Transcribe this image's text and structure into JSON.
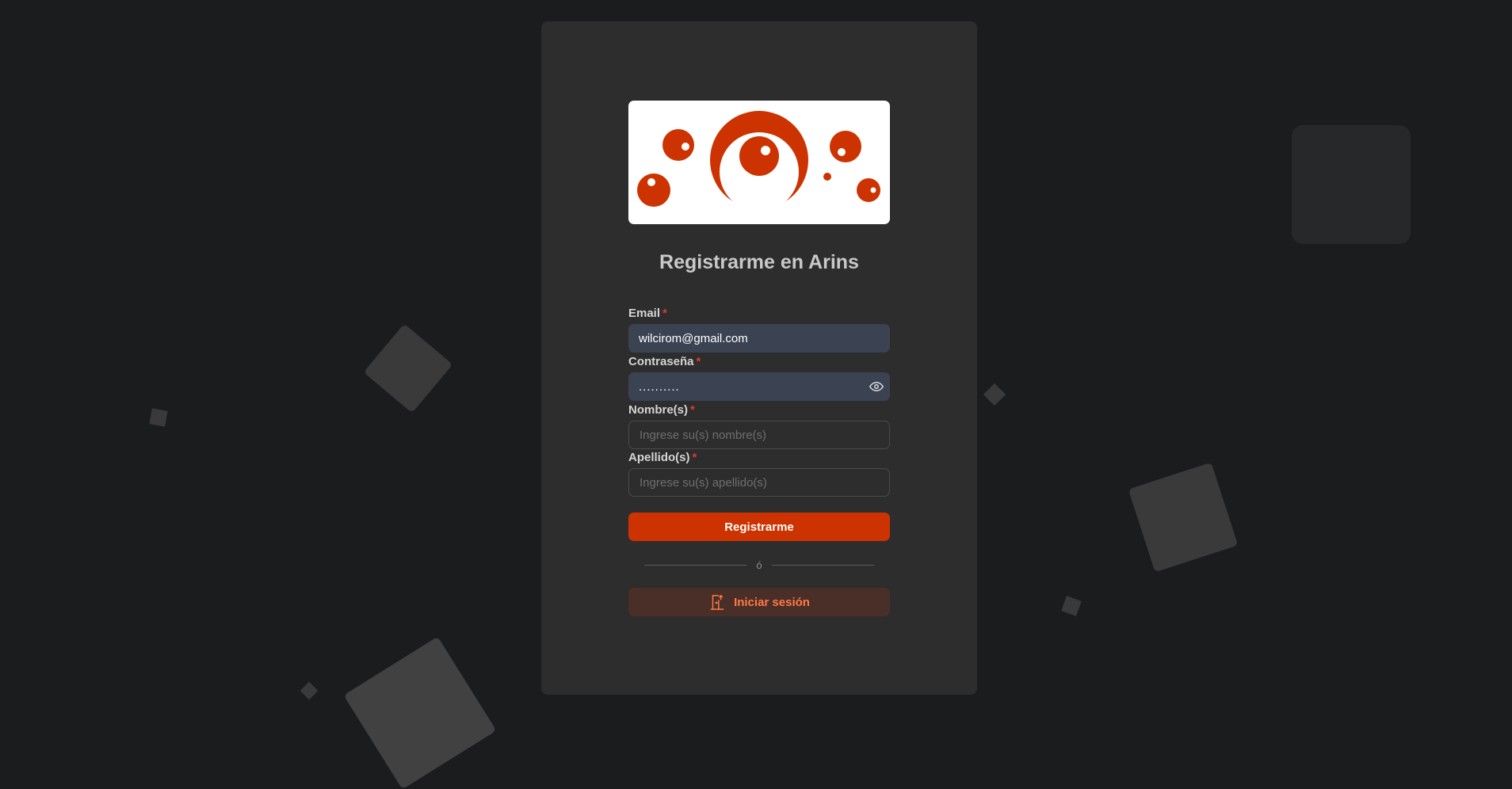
{
  "page": {
    "title": "Registrarme en Arins"
  },
  "logo": {
    "name": "arins-logo",
    "accent_color": "#cc3300"
  },
  "form": {
    "email": {
      "label": "Email",
      "required_mark": "*",
      "value": "wilcirom@gmail.com"
    },
    "password": {
      "label": "Contraseña",
      "required_mark": "*",
      "value": "..........",
      "icon": "eye-icon"
    },
    "first_name": {
      "label": "Nombre(s)",
      "required_mark": "*",
      "value": "",
      "placeholder": "Ingrese su(s) nombre(s)"
    },
    "last_name": {
      "label": "Apellido(s)",
      "required_mark": "*",
      "value": "",
      "placeholder": "Ingrese su(s) apellido(s)"
    },
    "submit_label": "Registrarme",
    "divider_text": "ó",
    "login_label": "Iniciar sesión",
    "login_icon": "door-enter-icon"
  },
  "colors": {
    "background": "#1b1c1e",
    "card": "#2d2d2d",
    "primary": "#cc3300",
    "secondary_text": "#ff7a45",
    "required": "#e03a2a",
    "filled_input": "#3b4252"
  }
}
